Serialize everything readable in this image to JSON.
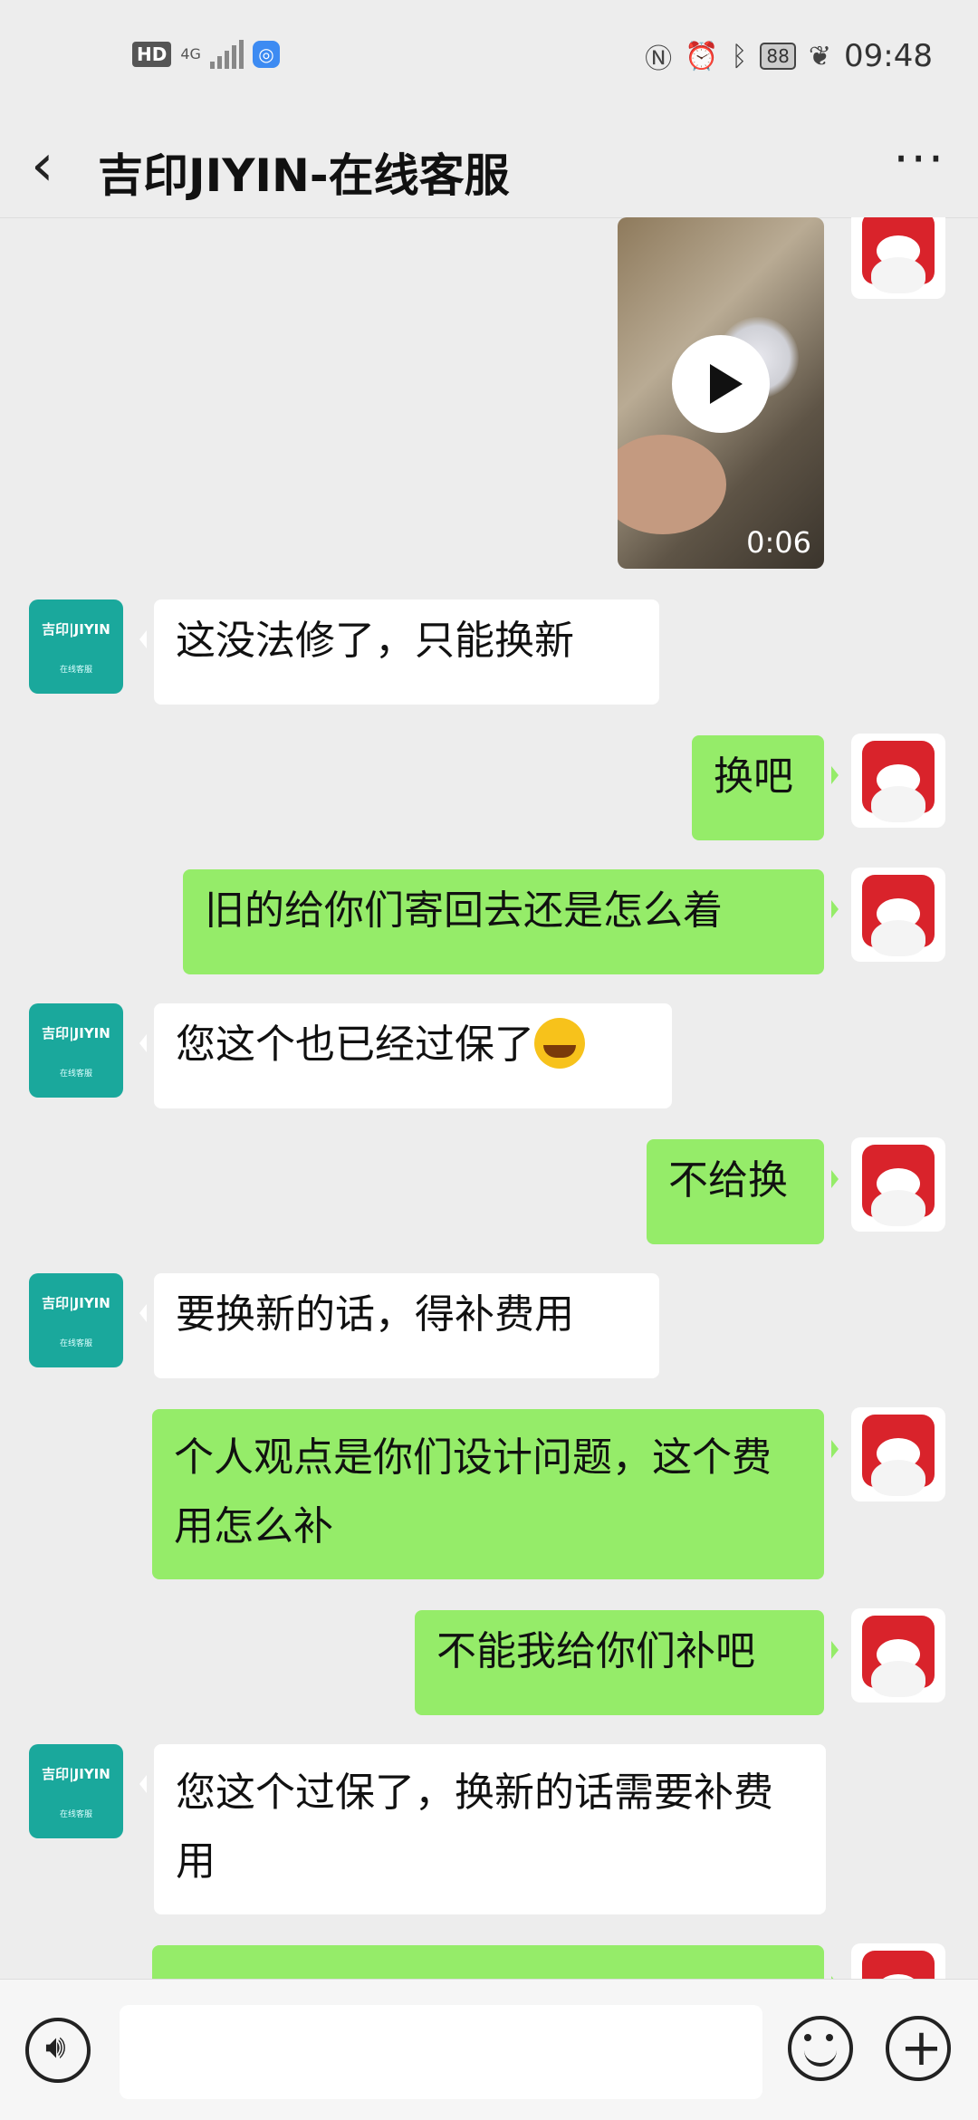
{
  "status_bar": {
    "hd": "HD",
    "network": "4G",
    "battery": "88",
    "time": "09:48"
  },
  "header": {
    "back_icon": "chevron-left-icon",
    "title": "吉印JIYIN-在线客服",
    "more_icon": "more-icon"
  },
  "cs_avatar": {
    "logo_text": "吉印|JIYIN",
    "sub_text": "在线客服"
  },
  "video": {
    "duration": "0:06"
  },
  "messages": [
    {
      "side": "in",
      "text": "这没法修了，只能换新"
    },
    {
      "side": "out",
      "text": "换吧"
    },
    {
      "side": "out",
      "text": "旧的给你们寄回去还是怎么着"
    },
    {
      "side": "in",
      "text": "您这个也已经过保了",
      "emoji": "crying-laughing-emoji"
    },
    {
      "side": "out",
      "text": "不给换"
    },
    {
      "side": "in",
      "text": "要换新的话，得补费用"
    },
    {
      "side": "out",
      "text": "个人观点是你们设计问题，这个费用怎么补"
    },
    {
      "side": "out",
      "text": "不能我给你们补吧"
    },
    {
      "side": "in",
      "text": "您这个过保了，换新的话需要补费用"
    }
  ],
  "input_bar": {
    "voice_icon": "voice-icon",
    "emoji_icon": "emoji-icon",
    "plus_icon": "plus-icon"
  }
}
